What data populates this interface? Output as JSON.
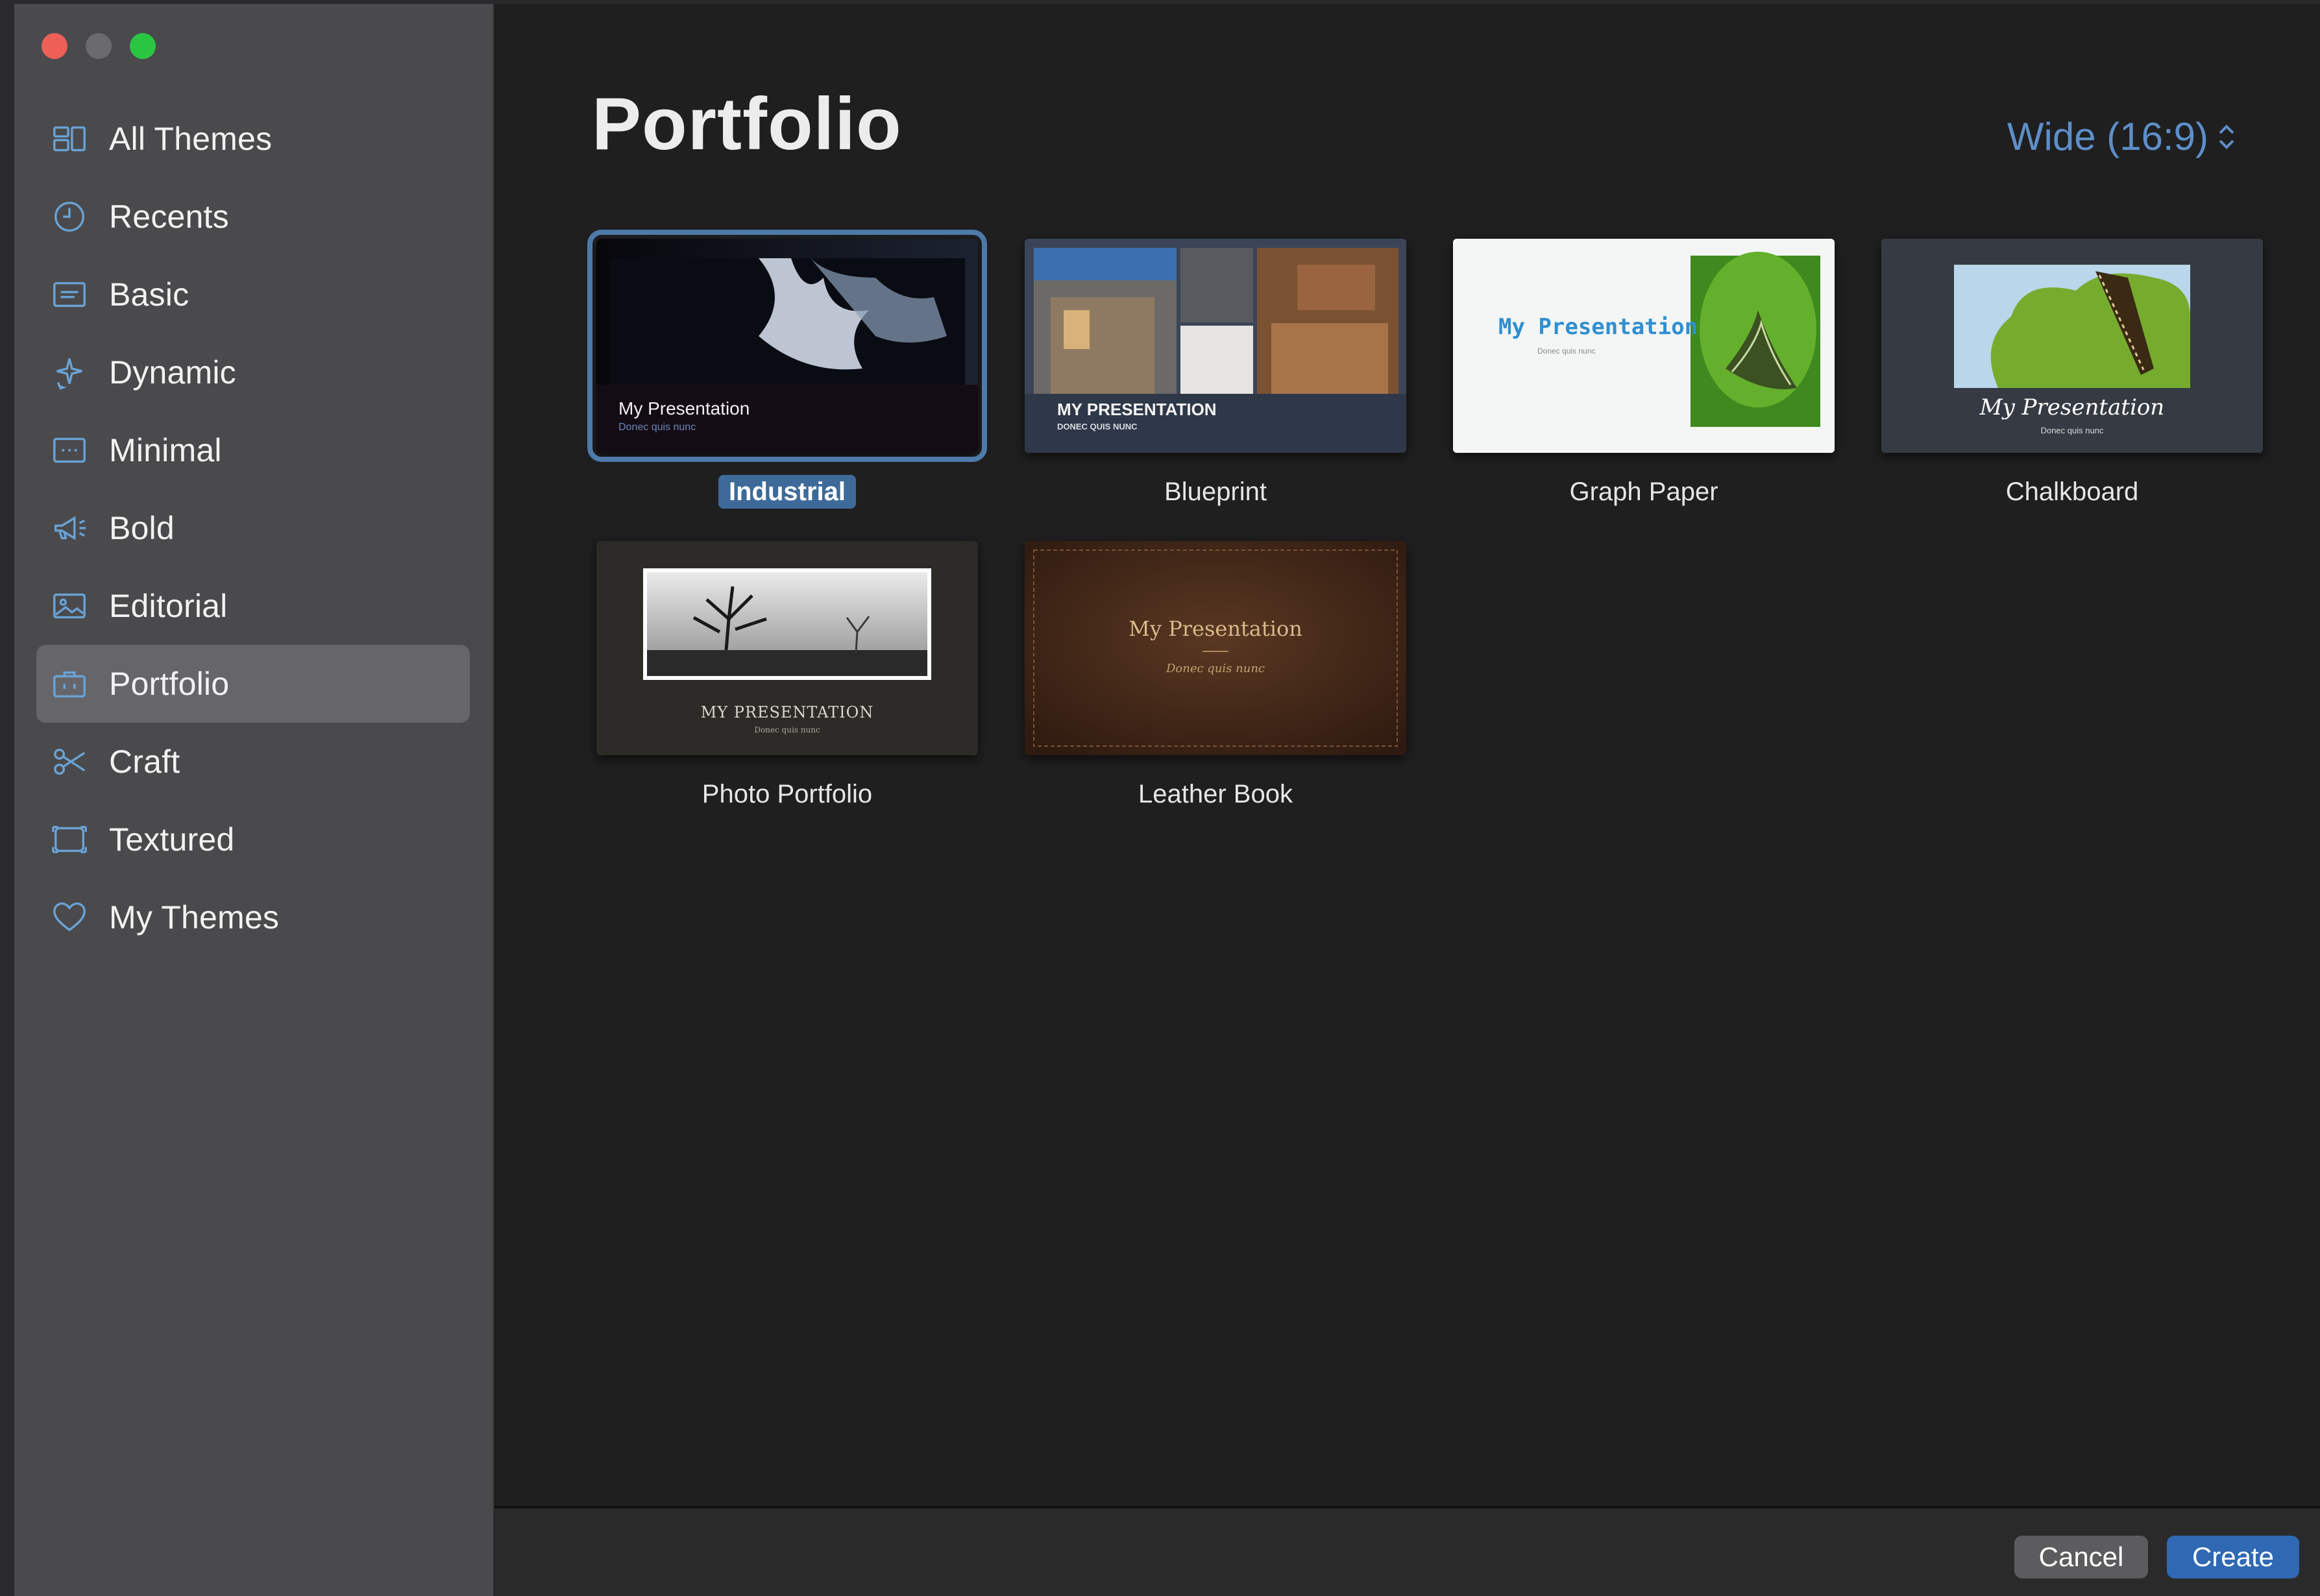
{
  "sidebar": {
    "items": [
      {
        "label": "All Themes",
        "icon": "grid-icon"
      },
      {
        "label": "Recents",
        "icon": "clock-icon"
      },
      {
        "label": "Basic",
        "icon": "slide-icon"
      },
      {
        "label": "Dynamic",
        "icon": "sparkles-icon"
      },
      {
        "label": "Minimal",
        "icon": "dotted-slide-icon"
      },
      {
        "label": "Bold",
        "icon": "megaphone-icon"
      },
      {
        "label": "Editorial",
        "icon": "photo-icon"
      },
      {
        "label": "Portfolio",
        "icon": "briefcase-icon"
      },
      {
        "label": "Craft",
        "icon": "scissors-icon"
      },
      {
        "label": "Textured",
        "icon": "frame-icon"
      },
      {
        "label": "My Themes",
        "icon": "heart-icon"
      }
    ],
    "selected": "Portfolio"
  },
  "main": {
    "title": "Portfolio",
    "aspect_ratio": "Wide (16:9)",
    "themes": [
      {
        "name": "Industrial",
        "selected": true,
        "thumb_title": "My Presentation",
        "thumb_subtitle": "Donec quis nunc"
      },
      {
        "name": "Blueprint",
        "selected": false,
        "thumb_title": "MY PRESENTATION",
        "thumb_subtitle": "DONEC QUIS NUNC"
      },
      {
        "name": "Graph Paper",
        "selected": false,
        "thumb_title": "My Presentation",
        "thumb_subtitle": "Donec quis nunc"
      },
      {
        "name": "Chalkboard",
        "selected": false,
        "thumb_title": "My Presentation",
        "thumb_subtitle": "Donec quis nunc"
      },
      {
        "name": "Photo Portfolio",
        "selected": false,
        "thumb_title": "MY PRESENTATION",
        "thumb_subtitle": "Donec quis nunc"
      },
      {
        "name": "Leather Book",
        "selected": false,
        "thumb_title": "My Presentation",
        "thumb_subtitle": "Donec quis nunc"
      }
    ]
  },
  "footer": {
    "cancel_label": "Cancel",
    "create_label": "Create"
  },
  "colors": {
    "accent": "#5d8fc9",
    "selection": "#4d7aa9",
    "create_button": "#2f69b3"
  }
}
